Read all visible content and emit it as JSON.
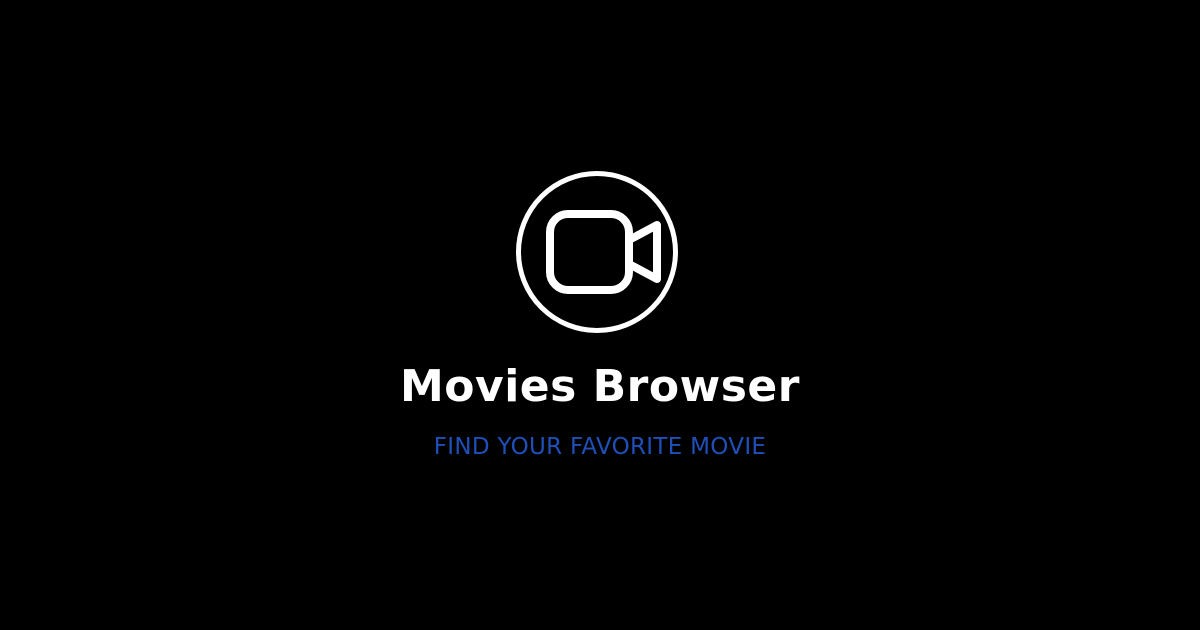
{
  "brand": {
    "logo_icon": "video-camera-icon",
    "title": "Movies Browser",
    "subtitle": "FIND YOUR FAVORITE MOVIE"
  },
  "colors": {
    "background": "#000000",
    "title": "#ffffff",
    "subtitle": "#1f4fb8",
    "logo": "#ffffff"
  }
}
